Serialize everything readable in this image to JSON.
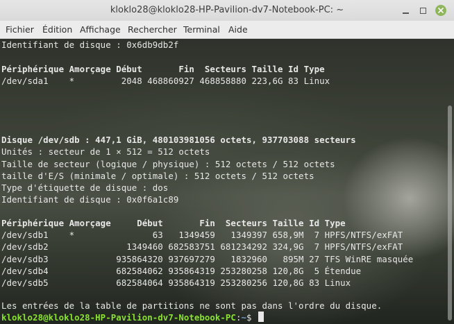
{
  "window": {
    "title": "kloklo28@kloklo28-HP-Pavilion-dv7-Notebook-PC: ~"
  },
  "menu": [
    "Fichier",
    "Édition",
    "Affichage",
    "Rechercher",
    "Terminal",
    "Aide"
  ],
  "terminal": {
    "lines": [
      "Identifiant de disque : 0x6db9db2f",
      "",
      "Périphérique Amorçage Début       Fin  Secteurs Taille Id Type",
      "/dev/sda1    *         2048 468860927 468858880 223,6G 83 Linux",
      "",
      "",
      "",
      "",
      "Disque /dev/sdb : 447,1 GiB, 480103981056 octets, 937703088 secteurs",
      "Unités : secteur de 1 × 512 = 512 octets",
      "Taille de secteur (logique / physique) : 512 octets / 512 octets",
      "taille d'E/S (minimale / optimale) : 512 octets / 512 octets",
      "Type d'étiquette de disque : dos",
      "Identifiant de disque : 0x0f6a1c89",
      "",
      "Périphérique Amorçage     Début       Fin  Secteurs Taille Id Type",
      "/dev/sdb1    *               63   1349459   1349397 658,9M  7 HPFS/NTFS/exFAT",
      "/dev/sdb2               1349460 682583751 681234292 324,9G  7 HPFS/NTFS/exFAT",
      "/dev/sdb3             935864320 937697279   1832960   895M 27 TFS WinRE masquée",
      "/dev/sdb4             682584062 935864319 253280258 120,8G  5 Étendue",
      "/dev/sdb5             682584064 935864319 253280256 120,8G 83 Linux",
      "",
      "Les entrées de la table de partitions ne sont pas dans l'ordre du disque."
    ],
    "prompt": {
      "user_host": "kloklo28@kloklo28-HP-Pavilion-dv7-Notebook-PC",
      "sep": ":",
      "path": "~",
      "symbol": "$ "
    }
  }
}
